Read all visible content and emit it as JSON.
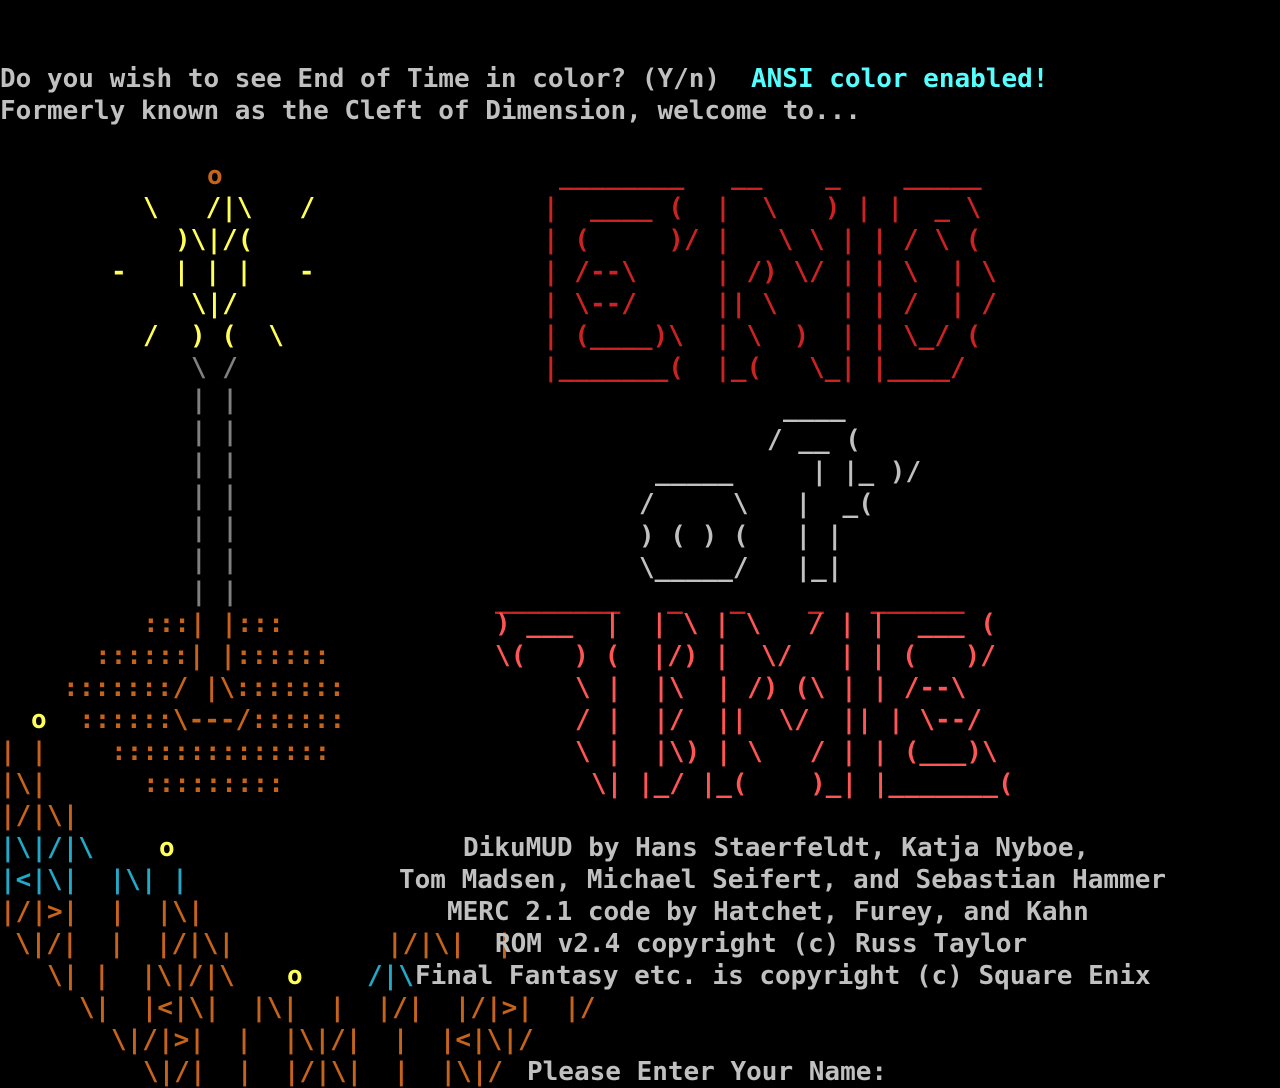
{
  "colors": {
    "background": "#000000",
    "text": "#c0c0c0",
    "cyan": "#55ffff",
    "gray": "#808080",
    "yellow": "#ffff55",
    "orange": "#c8641a",
    "red": "#cc2222",
    "light_red": "#ff5555",
    "teal": "#22a8c8",
    "white": "#ffffff"
  },
  "prompt": {
    "question": "Do you wish to see End of Time in color? (Y/n)",
    "answer": "ANSI color enabled!"
  },
  "intro": "Formerly known as the Cleft of Dimension, welcome to...",
  "logo_lines": [
    "________   __    _    _____",
    "|  ____ (  |  \\   ) | |  _ \\",
    "| (     )/ |   \\ \\ | | / \\ (",
    "| /--\\     | /) \\/ | | \\  | \\",
    "| \\--/     || \\    | | /  | /",
    "| (____)\\  | \\  )  | | \\_/ (",
    "|_______(  |_(   \\_| |____/",
    "____",
    "/ __ (",
    "_____     | |_ )/",
    "/     \\   |  _(",
    ") ( ) (   | |",
    "\\_____/   |_|",
    "________   _   _    _   ______",
    ") ___  |  | \\ | \\   / | |  ___ (",
    "\\(   ) (  |/) |  \\/   | | (   )/",
    "\\ |  |\\  | /) (\\ | | /--\\",
    "/ |  |/  ||  \\/  || | \\--/",
    "\\ |  |\\) | \\   / | | (___)\\",
    "\\| |_/ |_(    )_| |_______(",
    "o",
    "\\   /|\\   /",
    ")\\|/(",
    "-   | | |   -",
    "\\|/",
    "/  ) (  \\",
    "\\ /",
    "| |",
    ":::| |:::",
    "::::::| |::::::",
    ":::::::/ |\\:::::::",
    "::::::\\---/::::::",
    "::::::::::::::",
    ":::::::::",
    "| |",
    "|\\|",
    "|/|\\|",
    "|\\|/|\\",
    "|<|\\|  |\\| |",
    "|/|>|  |  |\\|",
    "\\|/|  |  |/|\\|",
    "\\| |  |\\|/|\\",
    "\\|  |<|\\|  |\\|  |  |/|  |/|>|  |/",
    "\\|/|>|  |  |\\|/|  |  |<|\\|/",
    "\\|/|  |  |/|\\|  |  |\\|/",
    "|/|\\|  |",
    "|/",
    "/|\\"
  ],
  "credits": [
    "DikuMUD by Hans Staerfeldt, Katja Nyboe,",
    "Tom Madsen, Michael Seifert, and Sebastian Hammer",
    "MERC 2.1 code by Hatchet, Furey, and Kahn",
    "ROM v2.4 copyright (c) Russ Taylor",
    "Final Fantasy etc. is copyright (c) Square Enix"
  ],
  "name_prompt": "Please Enter Your Name:"
}
